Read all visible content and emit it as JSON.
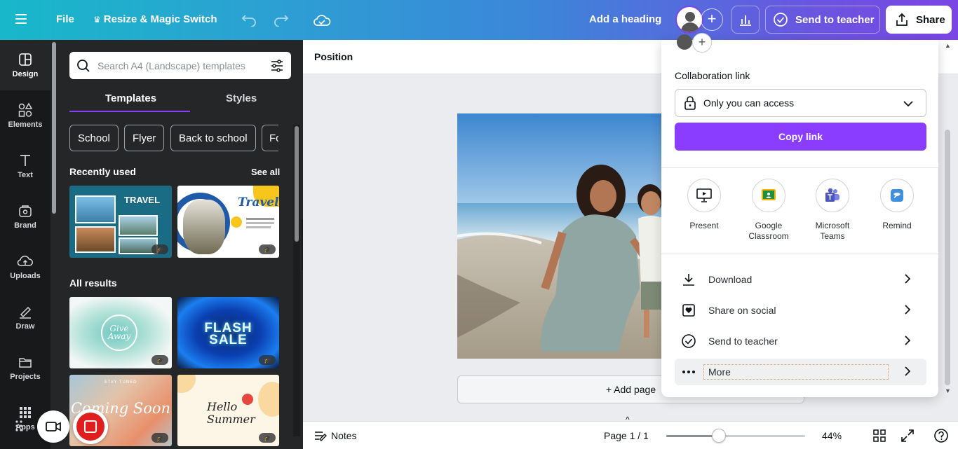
{
  "topbar": {
    "file": "File",
    "resize": "Resize & Magic Switch",
    "heading": "Add a heading",
    "send_to_teacher": "Send to teacher",
    "share": "Share"
  },
  "rail": {
    "items": [
      {
        "label": "Design",
        "icon": "design-icon"
      },
      {
        "label": "Elements",
        "icon": "elements-icon"
      },
      {
        "label": "Text",
        "icon": "text-icon"
      },
      {
        "label": "Brand",
        "icon": "brand-icon"
      },
      {
        "label": "Uploads",
        "icon": "uploads-icon"
      },
      {
        "label": "Draw",
        "icon": "draw-icon"
      },
      {
        "label": "Projects",
        "icon": "projects-icon"
      },
      {
        "label": "Apps",
        "icon": "apps-icon"
      }
    ]
  },
  "panel": {
    "search_placeholder": "Search A4 (Landscape) templates",
    "tabs": [
      "Templates",
      "Styles"
    ],
    "chips": [
      "School",
      "Flyer",
      "Back to school",
      "Fo"
    ],
    "recently_used": "Recently used",
    "see_all": "See all",
    "all_results": "All results",
    "templates": {
      "travel_title": "TRAVEL",
      "travel2_title": "Travel",
      "give_away": "Give Away",
      "flash_sale_1": "FLASH",
      "flash_sale_2": "SALE",
      "coming_soon": "Coming Soon",
      "hello_summer_1": "Hello",
      "hello_summer_2": "Summer",
      "stay_tuned": "STAY TUNED"
    }
  },
  "canvas": {
    "position": "Position",
    "add_page": "+ Add page"
  },
  "bottombar": {
    "notes": "Notes",
    "page": "Page 1 / 1",
    "zoom": "44%",
    "zoom_level": 0.38
  },
  "share_popup": {
    "collab_label": "Collaboration link",
    "access": "Only you can access",
    "copy_link": "Copy link",
    "options": [
      {
        "label1": "Present",
        "label2": "",
        "icon": "present-icon"
      },
      {
        "label1": "Google",
        "label2": "Classroom",
        "icon": "google-classroom-icon"
      },
      {
        "label1": "Microsoft",
        "label2": "Teams",
        "icon": "microsoft-teams-icon"
      },
      {
        "label1": "Remind",
        "label2": "",
        "icon": "remind-icon"
      }
    ],
    "menu": [
      "Download",
      "Share on social",
      "Send to teacher",
      "More"
    ]
  },
  "colors": {
    "accent": "#8b3dff",
    "rail_bg": "#18191b",
    "panel_bg": "#252627"
  }
}
